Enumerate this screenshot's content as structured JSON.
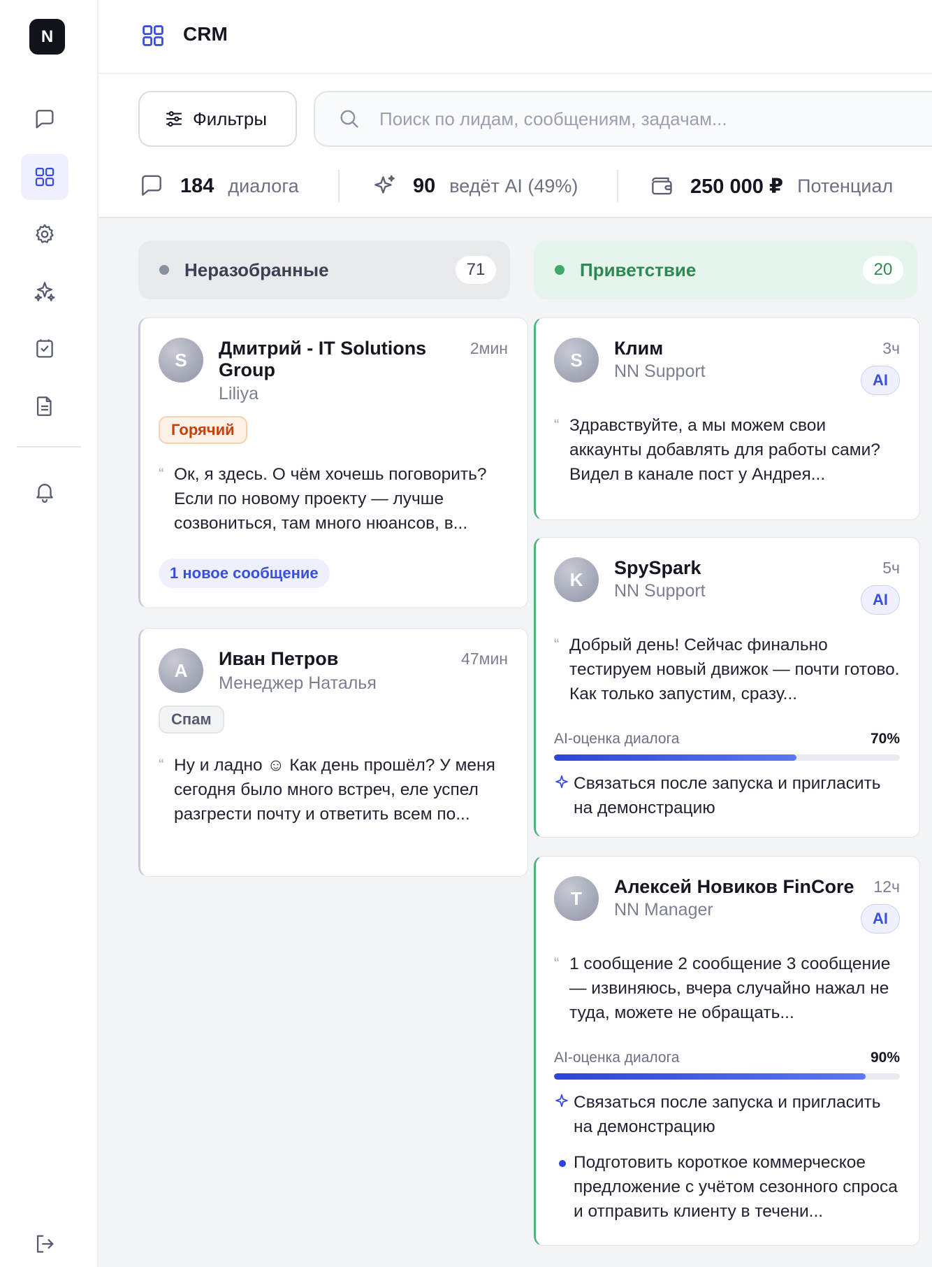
{
  "sidebar": {
    "logo": "N",
    "items": [
      {
        "icon": "chat-icon"
      },
      {
        "icon": "grid-icon",
        "active": true
      },
      {
        "icon": "gear-icon"
      },
      {
        "icon": "sparkles-icon"
      },
      {
        "icon": "checklist-icon"
      },
      {
        "icon": "document-icon"
      },
      {
        "icon": "bell-icon"
      },
      {
        "icon": "logout-icon"
      }
    ]
  },
  "header": {
    "title": "CRM",
    "icon": "grid-icon"
  },
  "toolbar": {
    "filters_label": "Фильтры",
    "search_placeholder": "Поиск по лидам, сообщениям, задачам...",
    "search_value": ""
  },
  "stats": {
    "dialogs": {
      "value": "184",
      "label": "диалога",
      "icon": "chat-icon"
    },
    "ai": {
      "value": "90",
      "label": "ведёт AI (49%)",
      "icon": "sparkles-icon"
    },
    "potential": {
      "value": "250 000 ₽",
      "label": "Потенциал",
      "icon": "wallet-icon"
    }
  },
  "columns": [
    {
      "name": "Неразобранные",
      "count": "71",
      "color": "#8a8f9e",
      "cards": [
        {
          "avatar": "S",
          "name": "Дмитрий - IT Solutions Group",
          "sub": "Liliya",
          "time": "2мин",
          "tag": "Горячий",
          "message": "Ок, я здесь. О чём хочешь поговорить? Если по новому проекту — лучше созвониться, там много нюансов, в...",
          "new_messages": "1 новое сообщение"
        },
        {
          "avatar": "А",
          "name": "Иван Петров",
          "sub": "Менеджер Наталья",
          "time": "47мин",
          "tag": "Спам",
          "message": "Ну и ладно ☺ Как день прошёл? У меня сегодня было много встреч, еле успел разгрести почту и ответить всем по..."
        }
      ]
    },
    {
      "name": "Приветствие",
      "count": "20",
      "color": "#3fa96a",
      "cards": [
        {
          "avatar": "S",
          "name": "Клим",
          "sub": "NN Support",
          "time": "3ч",
          "badge": "AI",
          "message": "Здравствуйте, а мы можем свои аккаунты добавлять для работы сами? Видел в канале пост у Андрея..."
        },
        {
          "avatar": "K",
          "name": "SpySpark",
          "sub": "NN Support",
          "time": "5ч",
          "badge": "AI",
          "message": "Добрый день! Сейчас финально тестируем новый движок — почти готово. Как только запустим, сразу...",
          "score_label": "AI-оценка диалога",
          "score_value": "70%",
          "score": 70,
          "tasks": [
            {
              "icon": "sparkle-icon",
              "text": "Связаться после запуска и пригласить на демонстрацию"
            }
          ]
        },
        {
          "avatar": "T",
          "name": "Алексей Новиков FinCore",
          "sub": "NN Manager",
          "time": "12ч",
          "badge": "AI",
          "message": "1 сообщение 2 сообщение 3 сообщение — извиняюсь, вчера случайно нажал не туда, можете не обращать...",
          "score_label": "AI-оценка диалога",
          "score_value": "90%",
          "score": 90,
          "tasks": [
            {
              "icon": "sparkle-icon",
              "text": "Связаться после запуска и пригласить на демонстрацию"
            },
            {
              "icon": "dot-icon",
              "text": "Подготовить короткое коммерческое предложение с учётом сезонного спроса и отправить клиенту в течени..."
            }
          ]
        }
      ]
    }
  ]
}
